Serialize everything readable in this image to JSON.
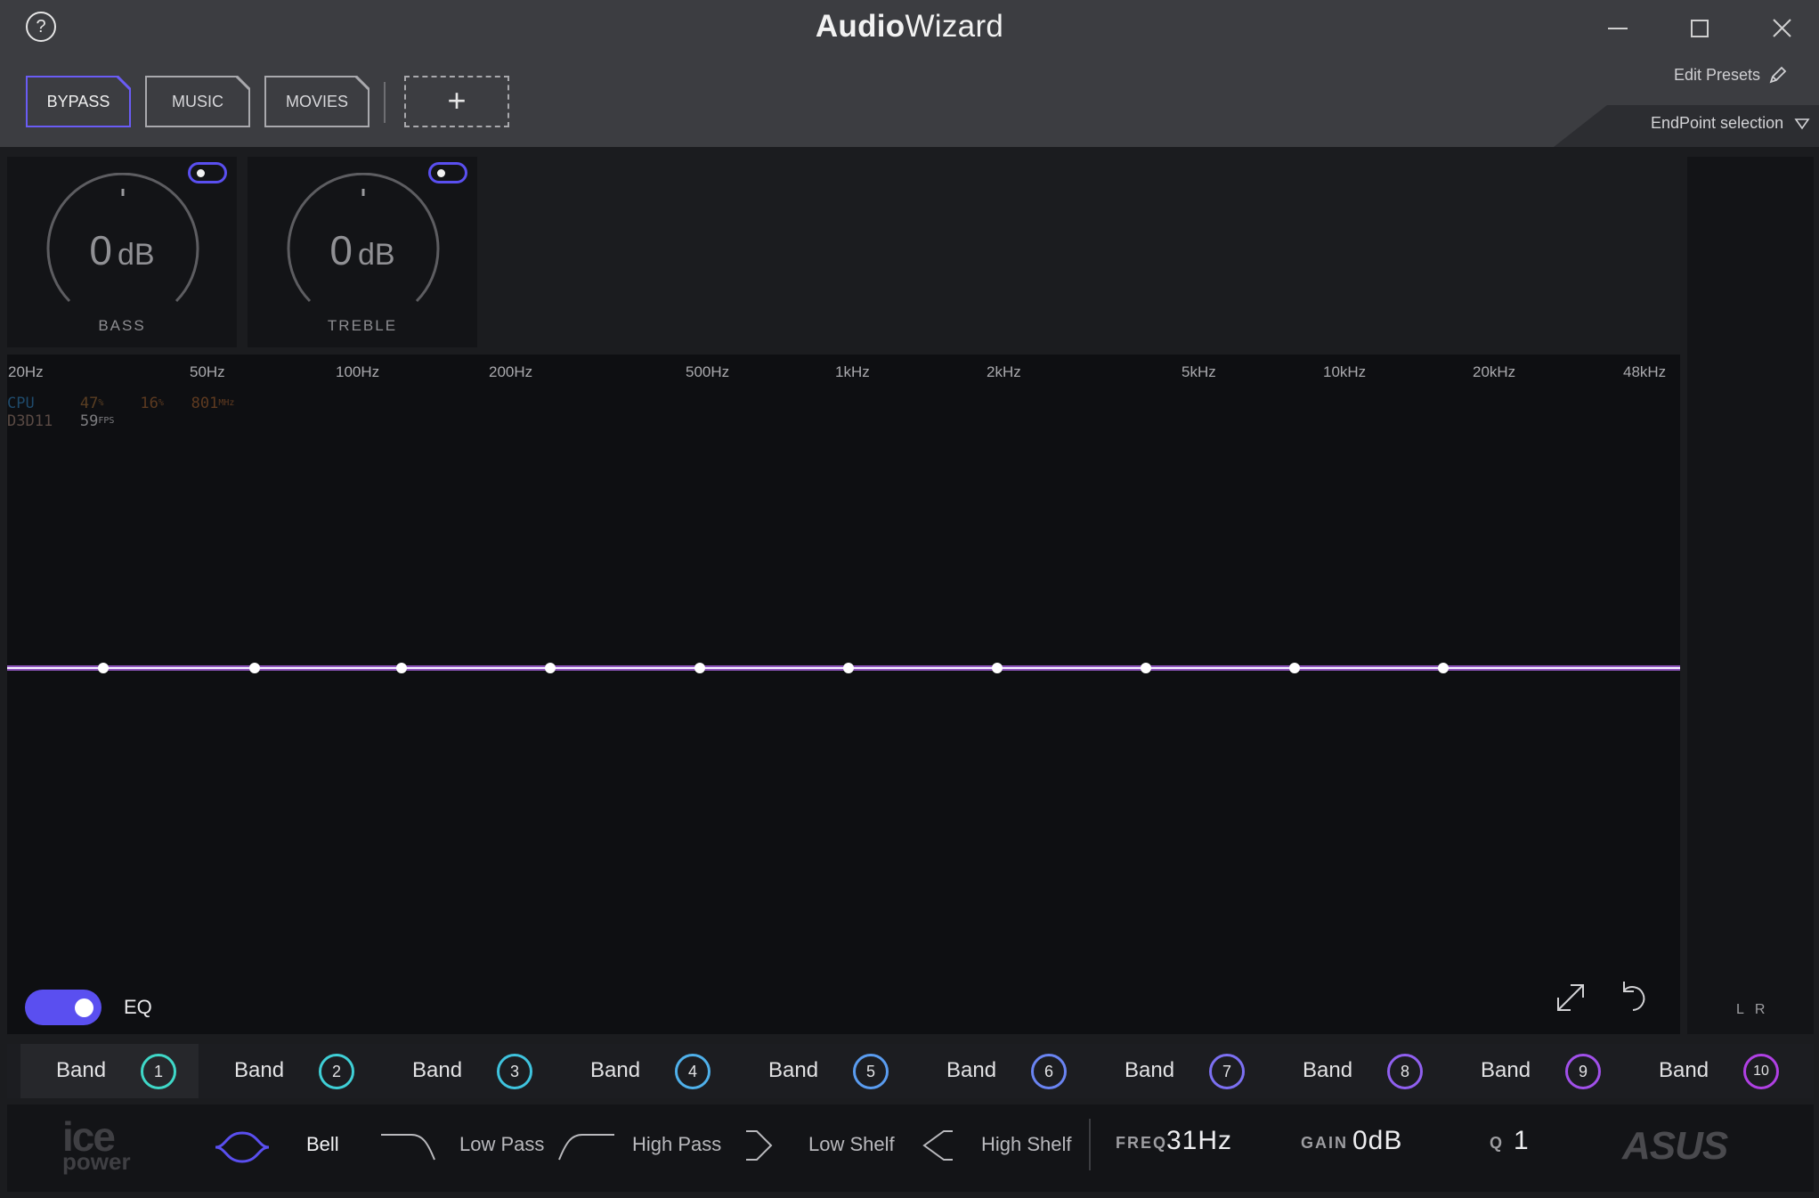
{
  "window": {
    "title_bold": "Audio",
    "title_light": "Wizard",
    "help_label": "?"
  },
  "presets": {
    "items": [
      "BYPASS",
      "MUSIC",
      "MOVIES"
    ],
    "active": "BYPASS",
    "add_label": "+"
  },
  "header_right": {
    "edit_presets": "Edit Presets",
    "endpoint_selection": "EndPoint selection"
  },
  "knobs": {
    "bass": {
      "value": "0",
      "unit": "dB",
      "label": "BASS",
      "enabled": true
    },
    "treble": {
      "value": "0",
      "unit": "dB",
      "label": "TREBLE",
      "enabled": true
    }
  },
  "eq": {
    "freq_axis": [
      "20Hz",
      "50Hz",
      "100Hz",
      "200Hz",
      "500Hz",
      "1kHz",
      "2kHz",
      "5kHz",
      "10kHz",
      "20kHz",
      "48kHz"
    ],
    "toggle_label": "EQ",
    "enabled": true,
    "curve_gain_db": 0,
    "band_points": 10
  },
  "overlay": {
    "cpu_label": "CPU",
    "cpu_value": "47",
    "cpu_unit": "%",
    "temp_value": "16",
    "temp_unit": "%",
    "clock_value": "801",
    "clock_unit": "MHz",
    "api_label": "D3D11",
    "fps_value": "59",
    "fps_unit": "FPS"
  },
  "meter": {
    "left": "L",
    "right": "R"
  },
  "bands": [
    {
      "label": "Band",
      "num": "1",
      "color": "#3fd8c8"
    },
    {
      "label": "Band",
      "num": "2",
      "color": "#3fcfd6"
    },
    {
      "label": "Band",
      "num": "3",
      "color": "#3fc3de"
    },
    {
      "label": "Band",
      "num": "4",
      "color": "#4fb0ea"
    },
    {
      "label": "Band",
      "num": "5",
      "color": "#5a9cf0"
    },
    {
      "label": "Band",
      "num": "6",
      "color": "#6a84f2"
    },
    {
      "label": "Band",
      "num": "7",
      "color": "#7c70f2"
    },
    {
      "label": "Band",
      "num": "8",
      "color": "#9060f0"
    },
    {
      "label": "Band",
      "num": "9",
      "color": "#a150ea"
    },
    {
      "label": "Band",
      "num": "10",
      "color": "#b040e4"
    }
  ],
  "active_band": "1",
  "filters": {
    "items": [
      "Bell",
      "Low Pass",
      "High Pass",
      "Low Shelf",
      "High Shelf"
    ],
    "active": "Bell"
  },
  "params": {
    "freq_key": "FREQ",
    "freq_value": "31Hz",
    "gain_key": "GAIN",
    "gain_value": "0dB",
    "q_key": "Q",
    "q_value": "1"
  },
  "branding": {
    "ice": "ice",
    "power": "power",
    "asus": "ASUS"
  },
  "colors": {
    "accent": "#5a4ff0",
    "curve": "#b06ae8"
  }
}
